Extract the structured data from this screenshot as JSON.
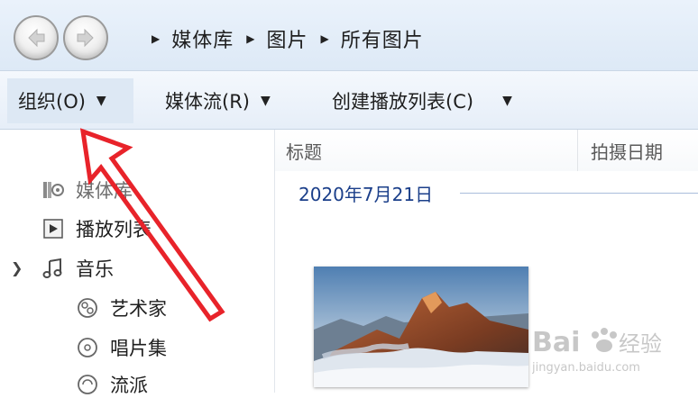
{
  "breadcrumb": {
    "items": [
      "媒体库",
      "图片",
      "所有图片"
    ]
  },
  "toolbar": {
    "organize": "组织(O)",
    "stream": "媒体流(R)",
    "create_playlist": "创建播放列表(C)"
  },
  "nav": {
    "library": "媒体库",
    "playlists": "播放列表",
    "music": "音乐",
    "artist": "艺术家",
    "album": "唱片集",
    "genre": "流派"
  },
  "columns": {
    "title": "标题",
    "date_taken": "拍摄日期"
  },
  "group": {
    "date": "2020年7月21日"
  },
  "watermark": {
    "brand": "Bai",
    "brand2": "经验",
    "url": "jingyan.baidu.com"
  },
  "colors": {
    "accent": "#1b3f8a",
    "annotation_arrow": "#e8232a"
  }
}
